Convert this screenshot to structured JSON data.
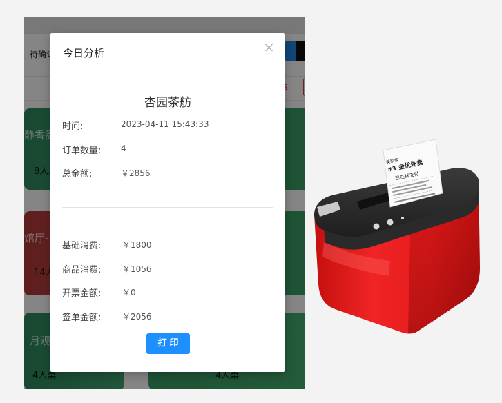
{
  "background_app": {
    "status_tag": "待确认",
    "red_count": "5",
    "tables": [
      {
        "name": "静香阁",
        "seats": "8人桌"
      },
      {
        "name": "馆厅-",
        "seats": "14人桌"
      },
      {
        "name": "月观",
        "seats": "4人桌"
      },
      {
        "name": "",
        "seats": "4人桌"
      }
    ]
  },
  "modal": {
    "title": "今日分析",
    "shop_name": "杏园茶舫",
    "rows": [
      {
        "label": "时间:",
        "value": "2023-04-11 15:43:33"
      },
      {
        "label": "订单数量:",
        "value": "4"
      },
      {
        "label": "总金额:",
        "value": "￥2856"
      },
      {
        "label": "基础消费:",
        "value": "￥1800"
      },
      {
        "label": "商品消费:",
        "value": "￥1056"
      },
      {
        "label": "开票金额:",
        "value": "￥0"
      },
      {
        "label": "签单金额:",
        "value": "￥2056"
      }
    ],
    "print_label": "打印"
  },
  "receipt": {
    "brand": "美家客",
    "order_no": "#3",
    "platform": "金优外卖",
    "payment": "已在线支付"
  },
  "colors": {
    "accent_blue": "#1e8fff",
    "table_green": "#3a9c6c",
    "table_red": "#c94646",
    "printer_red": "#e21b1b",
    "printer_top": "#2b2b2b"
  }
}
